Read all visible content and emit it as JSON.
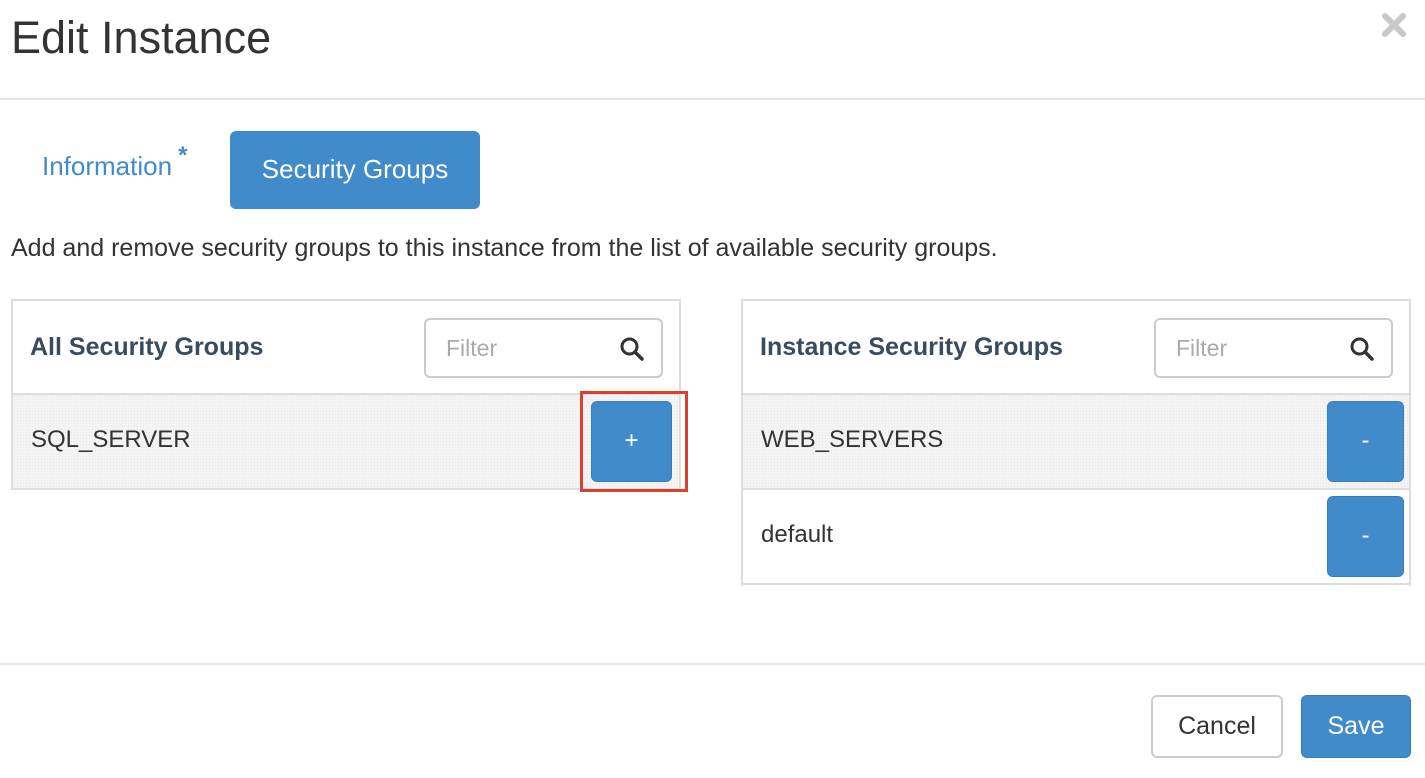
{
  "dialog": {
    "title": "Edit Instance",
    "close_icon": "close-icon"
  },
  "tabs": [
    {
      "label": "Information",
      "required_marker": "*",
      "active": false
    },
    {
      "label": "Security Groups",
      "active": true
    }
  ],
  "description": "Add and remove security groups to this instance from the list of available security groups.",
  "available": {
    "title": "All Security Groups",
    "filter_placeholder": "Filter",
    "items": [
      {
        "name": "SQL_SERVER",
        "action": "+"
      }
    ]
  },
  "allocated": {
    "title": "Instance Security Groups",
    "filter_placeholder": "Filter",
    "items": [
      {
        "name": "WEB_SERVERS",
        "action": "-"
      },
      {
        "name": "default",
        "action": "-"
      }
    ]
  },
  "footer": {
    "cancel_label": "Cancel",
    "save_label": "Save"
  },
  "colors": {
    "primary": "#428bca",
    "highlight": "#d9412c",
    "border": "#dddddd"
  }
}
